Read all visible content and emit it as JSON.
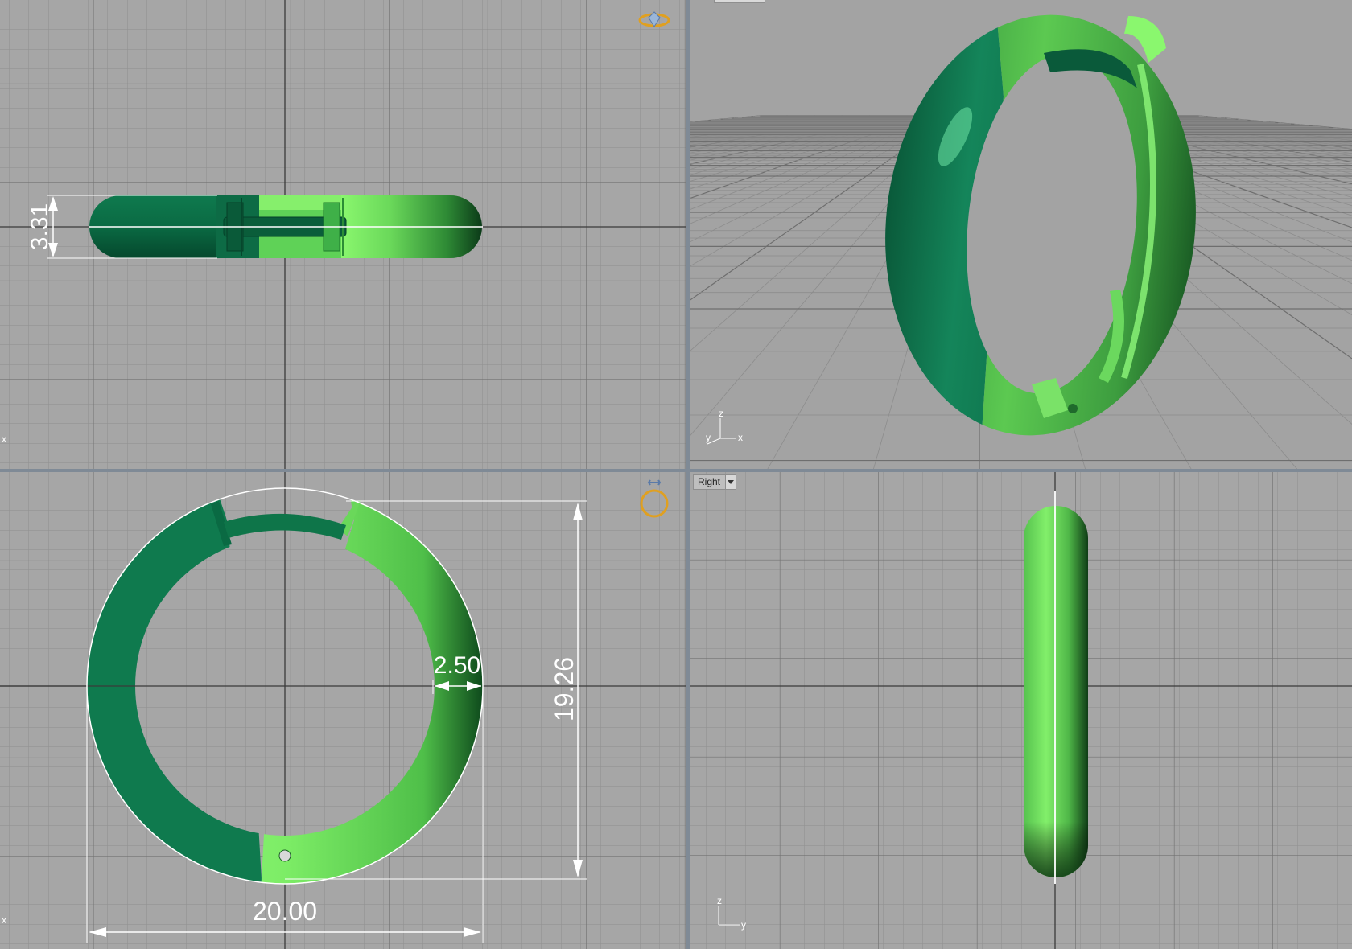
{
  "colors": {
    "viewport_bg": "#a6a6a6",
    "grid_minor": "#8f8f8f",
    "grid_major": "#6e6e6e",
    "axis_line": "#3a3a3a",
    "border": "#7f8a96",
    "dimension": "#ffffff",
    "ring_dark": "#0c7048",
    "ring_light": "#7ded66",
    "marker": "#e0a020"
  },
  "viewports": {
    "top": {
      "dimension_height": "3.31",
      "axis_label": "x",
      "icon": "ring-top-icon"
    },
    "perspective": {
      "axis_labels": {
        "z": "z",
        "y": "y",
        "x": "x"
      }
    },
    "front": {
      "dimension_width": "20.00",
      "dimension_height": "19.26",
      "dimension_thickness": "2.50",
      "axis_label": "x",
      "icon": "ring-front-icon"
    },
    "right": {
      "label": "Right",
      "axis_labels": {
        "z": "z",
        "y": "y"
      }
    }
  }
}
